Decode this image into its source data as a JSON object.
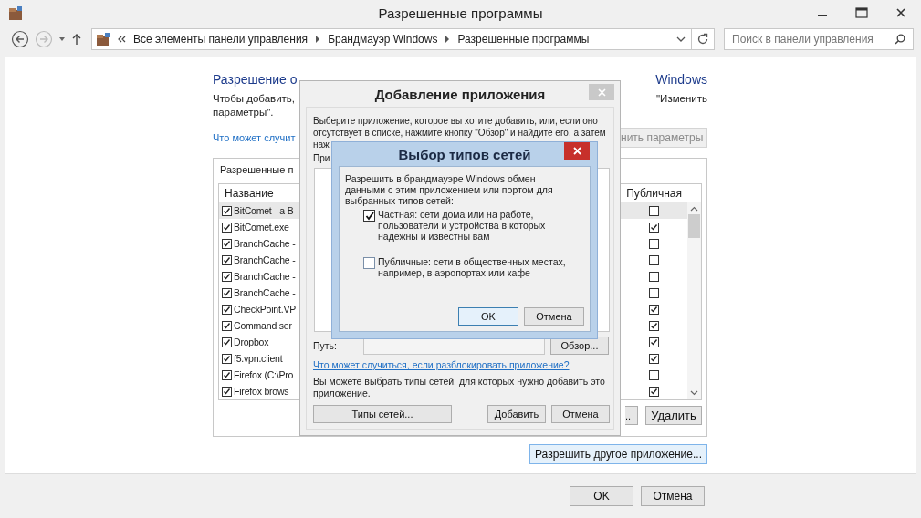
{
  "window": {
    "title": "Разрешенные программы"
  },
  "address_bar": {
    "breadcrumbs": [
      "Все элементы панели управления",
      "Брандмауэр Windows",
      "Разрешенные программы"
    ]
  },
  "search": {
    "placeholder": "Поиск в панели управления"
  },
  "page": {
    "heading_parts": [
      "Разрешение о",
      "Windows"
    ],
    "description_parts": [
      "Чтобы добавить,",
      "\"Изменить",
      "параметры\"."
    ],
    "link": "Что может случит",
    "change_settings_button": {
      "label": "нить параметры",
      "disabled": true
    }
  },
  "allowed_apps": {
    "label": "Разрешенные п",
    "columns": [
      "Название",
      "Публичная"
    ],
    "rows": [
      {
        "name": "BitComet - a B",
        "checked": true,
        "public": false,
        "selected": true
      },
      {
        "name": "BitComet.exe",
        "checked": true,
        "public": true,
        "selected": false
      },
      {
        "name": "BranchCache -",
        "checked": true,
        "public": false,
        "selected": false
      },
      {
        "name": "BranchCache -",
        "checked": true,
        "public": false,
        "selected": false
      },
      {
        "name": "BranchCache -",
        "checked": true,
        "public": false,
        "selected": false
      },
      {
        "name": "BranchCache -",
        "checked": true,
        "public": false,
        "selected": false
      },
      {
        "name": "CheckPoint.VP",
        "checked": true,
        "public": true,
        "selected": false
      },
      {
        "name": "Command ser",
        "checked": true,
        "public": true,
        "selected": false
      },
      {
        "name": "Dropbox",
        "checked": true,
        "public": true,
        "selected": false
      },
      {
        "name": "f5.vpn.client",
        "checked": true,
        "public": true,
        "selected": false
      },
      {
        "name": "Firefox (C:\\Pro",
        "checked": true,
        "public": false,
        "selected": false
      },
      {
        "name": "Firefox brows",
        "checked": true,
        "public": true,
        "selected": false
      }
    ],
    "buttons": [
      "..",
      "Удалить"
    ]
  },
  "allow_other_button": "Разрешить другое приложение...",
  "add_app_dialog": {
    "title": "Добавление приложения",
    "intro_lines": [
      "Выберите приложение, которое вы хотите добавить, или, если оно",
      "отсутствует в списке, нажмите кнопку \"Обзор\" и найдите его, а затем",
      "наж"
    ],
    "list_label": "При",
    "path_label": "Путь:",
    "browse_button": "Обзор...",
    "link": "Что может случиться, если разблокировать приложение?",
    "note": "Вы можете выбрать типы сетей, для которых нужно добавить это приложение.",
    "buttons": [
      "Типы сетей...",
      "Добавить",
      "Отмена"
    ]
  },
  "network_dialog": {
    "title": "Выбор типов сетей",
    "text": "Разрешить в брандмауэре Windows обмен данными с этим приложением или портом для выбранных типов сетей:",
    "options": [
      {
        "label": "Частная: сети дома или на работе, пользователи и устройства в которых надежны и известны вам",
        "checked": true
      },
      {
        "label": "Публичные: сети в общественных местах, например, в аэропортах или кафе",
        "checked": false
      }
    ],
    "buttons": [
      {
        "label": "OK",
        "default": true
      },
      {
        "label": "Отмена",
        "default": false
      }
    ]
  },
  "footer_buttons": [
    "OK",
    "Отмена"
  ]
}
